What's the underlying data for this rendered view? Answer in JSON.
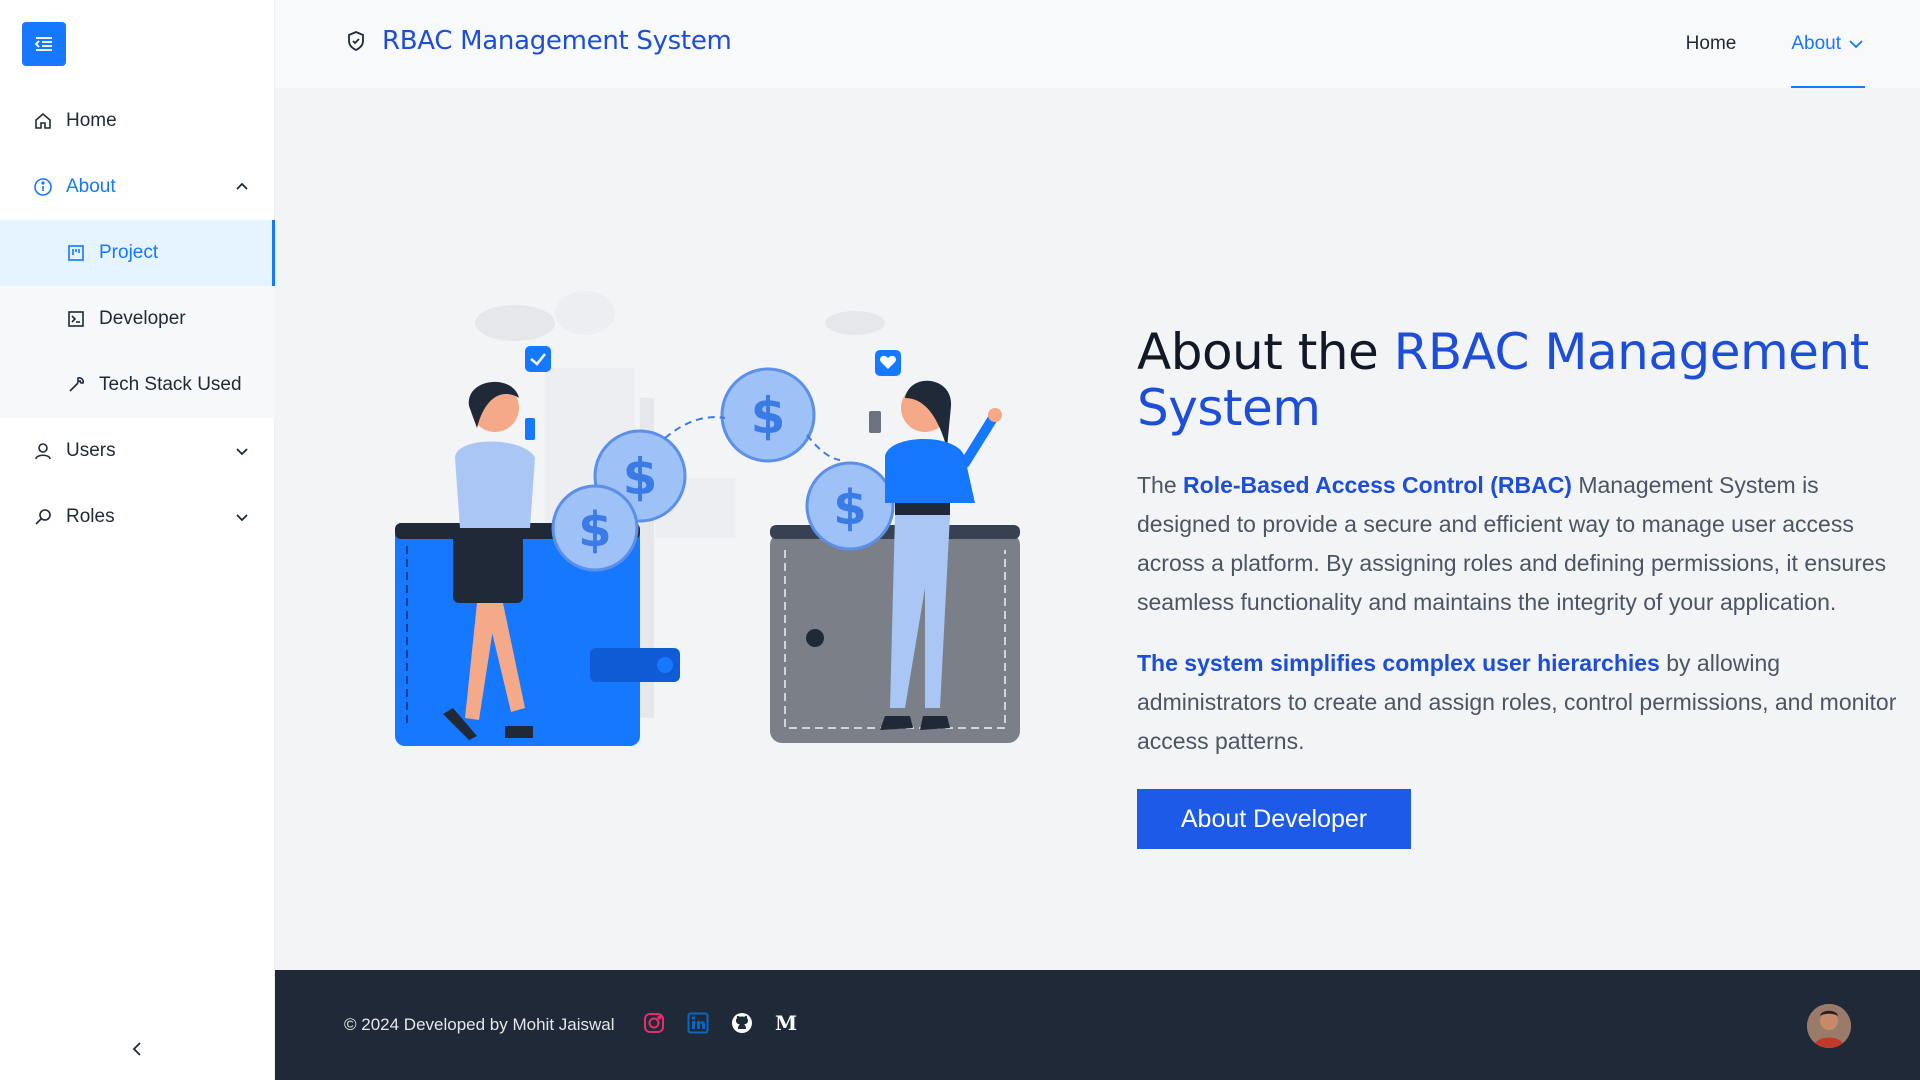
{
  "sidebar": {
    "toggle_icon": "menu-fold-icon",
    "items": [
      {
        "label": "Home",
        "icon": "home-icon"
      },
      {
        "label": "About",
        "icon": "info-circle-icon",
        "expanded": true
      },
      {
        "label": "Users",
        "icon": "user-icon"
      },
      {
        "label": "Roles",
        "icon": "key-icon"
      }
    ],
    "about_children": [
      {
        "label": "Project",
        "icon": "project-icon",
        "selected": true
      },
      {
        "label": "Developer",
        "icon": "terminal-icon"
      },
      {
        "label": "Tech Stack Used",
        "icon": "tool-icon"
      }
    ],
    "collapse_icon": "chevron-left-icon"
  },
  "header": {
    "brand": "RBAC Management System",
    "brand_icon": "shield-check-icon",
    "nav": [
      {
        "label": "Home"
      },
      {
        "label": "About",
        "active": true
      }
    ]
  },
  "main": {
    "title_prefix": "About the ",
    "title_accent": "RBAC Management System",
    "para1": {
      "before": "The ",
      "highlight": "Role-Based Access Control (RBAC)",
      "after": " Management System is designed to provide a secure and efficient way to manage user access across a platform. By assigning roles and defining permissions, it ensures seamless functionality and maintains the integrity of your application."
    },
    "para2": {
      "highlight": "The system simplifies complex user hierarchies",
      "after": " by allowing administrators to create and assign roles, control permissions, and monitor access patterns."
    },
    "cta_label": "About Developer"
  },
  "footer": {
    "copyright": "© 2024 Developed by Mohit Jaiswal",
    "socials": [
      "instagram-icon",
      "linkedin-icon",
      "github-icon",
      "medium-icon"
    ]
  },
  "colors": {
    "primary": "#1677ff",
    "accent_text": "#1d4ed8",
    "button": "#1d5ae8",
    "footer_bg": "#1f2937",
    "instagram": "#e1306c",
    "linkedin": "#0a66c2"
  }
}
